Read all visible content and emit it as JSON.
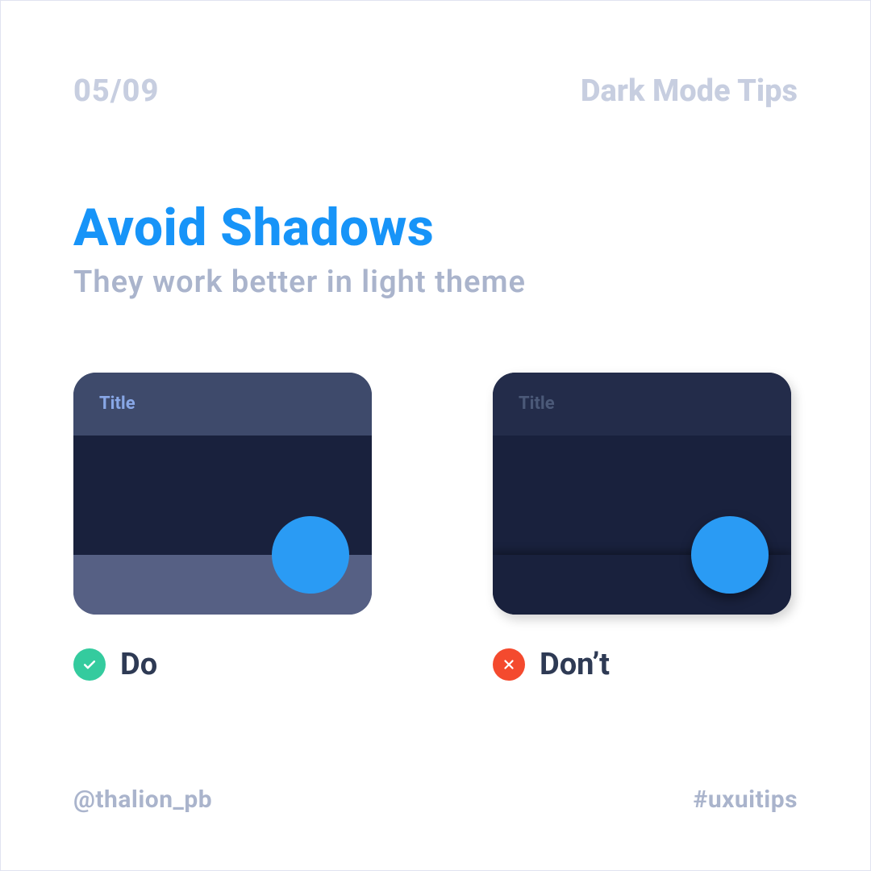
{
  "pageCounter": "05/09",
  "seriesTitle": "Dark Mode Tips",
  "headline": "Avoid Shadows",
  "subhead": "They work better in light theme",
  "cards": {
    "do": {
      "title": "Title",
      "label": "Do"
    },
    "dont": {
      "title": "Title",
      "label": "Don’t"
    }
  },
  "footer": {
    "handle": "@thalion_pb",
    "hashtag": "#uxuitips"
  }
}
